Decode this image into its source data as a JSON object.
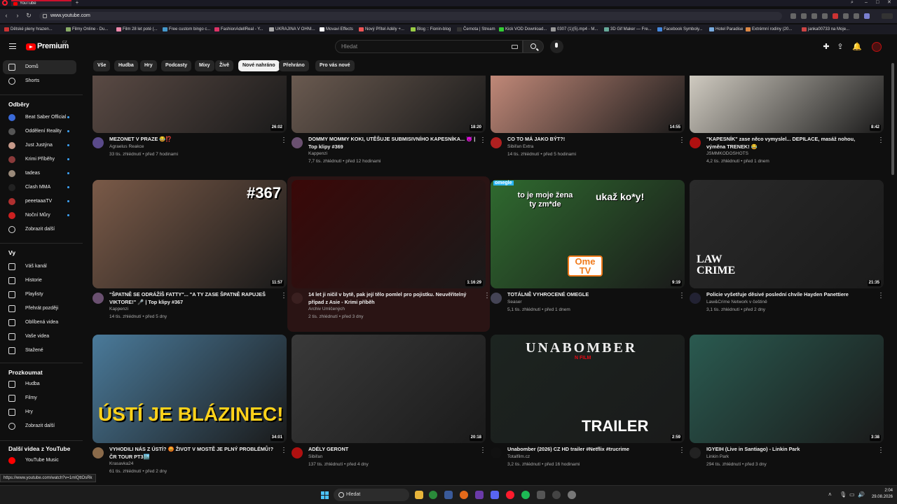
{
  "browser": {
    "tab_title": "YouTube",
    "url": "www.youtube.com",
    "bookmarks": [
      "Dětské pleny hrazen...",
      "Filmy Online - Du...",
      "Film 28 let poté (...",
      "Free custom bingo c...",
      "FashionAdellReal - Y...",
      "UKRAJINA V OHNI...",
      "Movavi Effects",
      "Nový Přítel Adély +...",
      "Blog :: Fionin-blog",
      "Černota | Stream",
      "Kick VOD Download...",
      "0307 (1)(5).mp4 - M...",
      "3D Gif Maker — Fre...",
      "Facebook Symboly...",
      "Hotel Paradise",
      "Extrémní rodiny (20...",
      "janka00733 na Moje..."
    ],
    "status_url": "https://www.youtube.com/watch?v=1mlQttOsRk"
  },
  "masthead": {
    "brand": "Premium",
    "country": "CZ",
    "search_placeholder": "Hledat"
  },
  "sidebar": {
    "main": [
      {
        "label": "Domů"
      },
      {
        "label": "Shorts"
      }
    ],
    "subs_heading": "Odběry",
    "subs": [
      {
        "label": "Beat Saber Official",
        "color": "#3a6ad8"
      },
      {
        "label": "Oddělení Reality",
        "color": "#555"
      },
      {
        "label": "Just Justýna",
        "color": "#c79a8a"
      },
      {
        "label": "Krimi Příběhy",
        "color": "#8a3a3a"
      },
      {
        "label": "tadeas",
        "color": "#9a8a7a"
      },
      {
        "label": "Clash MMA",
        "color": "#222"
      },
      {
        "label": "peeetaaaTV",
        "color": "#b03030"
      },
      {
        "label": "Noční Můry",
        "color": "#cc2020"
      }
    ],
    "subs_more": "Zobrazit další",
    "you_heading": "Vy",
    "you": [
      {
        "label": "Váš kanál"
      },
      {
        "label": "Historie"
      },
      {
        "label": "Playlisty"
      },
      {
        "label": "Přehrát později"
      },
      {
        "label": "Oblíbená videa"
      },
      {
        "label": "Vaše videa"
      },
      {
        "label": "Stažené"
      }
    ],
    "explore_heading": "Prozkoumat",
    "explore": [
      {
        "label": "Hudba"
      },
      {
        "label": "Filmy"
      },
      {
        "label": "Hry"
      }
    ],
    "explore_more": "Zobrazit další",
    "more_heading": "Další videa z YouTube",
    "more": [
      {
        "label": "YouTube Music"
      }
    ]
  },
  "chips": [
    "Vše",
    "Hudba",
    "Hry",
    "Podcasty",
    "Mixy",
    "Živě",
    "Nové nahráno",
    "Přehráno",
    "Pro vás nové"
  ],
  "active_chip": "Nové nahráno",
  "videos": [
    {
      "title": "MEZONET V PRAZE 😂⁉️",
      "channel": "Agraelus Reakce",
      "views": "33 tis. zhlédnutí",
      "age": "před 7 hodinami",
      "duration": "26:02",
      "av": "#5a4a8a",
      "thumb": "#5a4a44"
    },
    {
      "title": "DOMMY MOMMY KOKI, UTĚŠUJE SUBMISIVNÍHO KAPESNÍKA... 👿 | Top klipy #369",
      "channel": "Kappenzi",
      "views": "7,7 tis. zhlédnutí",
      "age": "před 12 hodinami",
      "duration": "18:20",
      "av": "#6a5070",
      "thumb": "#6a5a50"
    },
    {
      "title": "CO TO MÁ JAKO BÝT?!",
      "channel": "Sibiřan Extra",
      "views": "14 tis. zhlédnutí",
      "age": "před 5 hodinami",
      "duration": "14:55",
      "av": "#b02020",
      "thumb": "#c08878"
    },
    {
      "title": "\"KAPESNÍK\" zase něco vymyslel... DEPILACE, masáž nohou, výměna TRENEK! 😂",
      "channel": "JSMMKODOSHOTS",
      "views": "4,2 tis. zhlédnutí",
      "age": "před 1 dnem",
      "duration": "8:42",
      "av": "#b01010",
      "thumb": "#cfcac0"
    },
    {
      "title": "\"ŠPATNĚ SE ODRÁŽÍŠ FATTY\"... \"A TY ZASE ŠPATNĚ RAPUJEŠ VIKTORE!\" 🎤 | Top klipy #367",
      "channel": "Kappenzi",
      "views": "14 tis. zhlédnutí",
      "age": "před 5 dny",
      "duration": "11:57",
      "av": "#6a5070",
      "thumb": "#7a5a48",
      "overlay": "#367"
    },
    {
      "title": "14 let ji ničil v bytě, pak její tělo pomlel pro pojistku. Neuvěřitelný případ z Asie - Krimi příběh",
      "channel": "Archiv Umlčených",
      "views": "2 tis. zhlédnutí",
      "age": "před 3 dny",
      "duration": "1:16:29",
      "av": "#3a2020",
      "thumb": "#3a0808"
    },
    {
      "title": "TOTÁLNĚ VYHROCENÉ OMEGLE",
      "channel": "Seaser",
      "views": "5,1 tis. zhlédnutí",
      "age": "před 1 dnem",
      "duration": "9:19",
      "av": "#445",
      "thumb": "#2f6a2f",
      "overlay": "to je moje žena ty zm*de",
      "overlay2": "ukaž ko*y!",
      "badge": "Ome TV",
      "brand_tl": "omegle"
    },
    {
      "title": "Policie vyšetřuje děsivé poslední chvíle Hayden Panettiere",
      "channel": "Law&Crime Network v češtině",
      "views": "3,1 tis. zhlédnutí",
      "age": "před 2 dny",
      "duration": "21:35",
      "av": "#223",
      "thumb": "#2a2a2a",
      "overlay": "LAW CRIME"
    },
    {
      "title": "VYHODILI NÁS Z ÚSTÍ? 😡 ŽIVOT V MOSTĚ JE PLNÝ PROBLÉMŮ!? ČR TOUR PT3🏙️",
      "channel": "Krasavka24",
      "views": "61 tis. zhlédnutí",
      "age": "před 2 dny",
      "duration": "34:01",
      "av": "#8a6a4a",
      "thumb": "#4a7a9a",
      "overlay": "ÚSTÍ JE BLÁZINEC!"
    },
    {
      "title": "ADÉLY GERONT",
      "channel": "Sibiřan",
      "views": "137 tis. zhlédnutí",
      "age": "před 4 dny",
      "duration": "20:18",
      "av": "#b01010",
      "thumb": "#3a3a3a"
    },
    {
      "title": "Unabomber (2026) CZ HD trailer #Netflix #trucrime",
      "channel": "Totalfilm.cz",
      "views": "3,2 tis. zhlédnutí",
      "age": "před 16 hodinami",
      "duration": "2:59",
      "av": "#111",
      "thumb": "#1c2420",
      "overlay": "UNABOMBER",
      "overlay2": "TRAILER",
      "brand_tl": "N FILM"
    },
    {
      "title": "IGYEIH (Live in Santiago) - Linkin Park",
      "channel": "Linkin Park",
      "views": "294 tis. zhlédnutí",
      "age": "před 3 dny",
      "duration": "3:38",
      "av": "#222",
      "thumb": "#2a5a50"
    }
  ],
  "taskbar": {
    "search": "Hledat",
    "time": "2:04",
    "date": "29.08.2026"
  },
  "icons": {
    "home": "home-icon",
    "shorts": "shorts-icon",
    "search": "search-icon",
    "mic": "mic-icon",
    "create": "create-icon",
    "bell": "bell-icon"
  }
}
